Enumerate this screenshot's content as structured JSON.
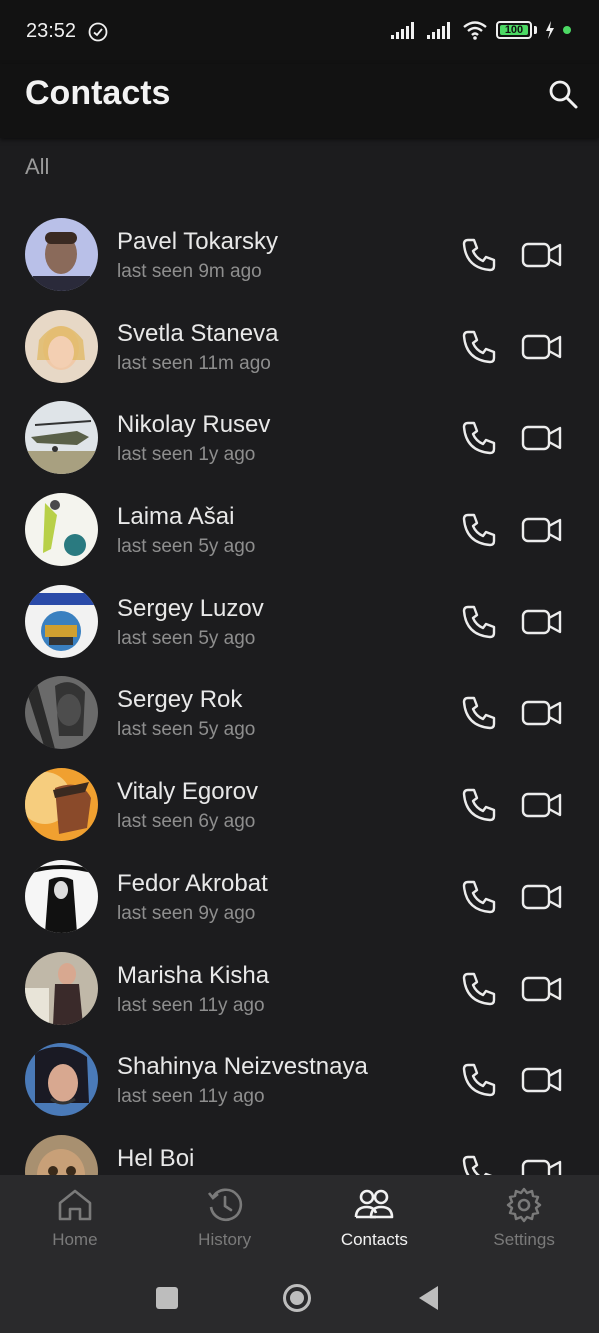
{
  "status_bar": {
    "time": "23:52",
    "battery": "100",
    "icons": [
      "check-circle-icon",
      "signal-icon",
      "signal-icon",
      "wifi-icon",
      "battery-icon",
      "charging-icon"
    ]
  },
  "app_bar": {
    "title": "Contacts",
    "search_icon": "search-icon"
  },
  "section": {
    "label": "All"
  },
  "contacts": [
    {
      "name": "Pavel Tokarsky",
      "status": "last seen 9m ago"
    },
    {
      "name": "Svetla Staneva",
      "status": "last seen 11m ago"
    },
    {
      "name": "Nikolay Rusev",
      "status": "last seen 1y ago"
    },
    {
      "name": "Laima Ašai",
      "status": "last seen 5y ago"
    },
    {
      "name": "Sergey Luzov",
      "status": "last seen 5y ago"
    },
    {
      "name": "Sergey Rok",
      "status": "last seen 5y ago"
    },
    {
      "name": "Vitaly Egorov",
      "status": "last seen 6y ago"
    },
    {
      "name": "Fedor Akrobat",
      "status": "last seen 9y ago"
    },
    {
      "name": "Marisha Kisha",
      "status": "last seen 11y ago"
    },
    {
      "name": "Shahinya Neizvestnaya",
      "status": "last seen 11y ago"
    },
    {
      "name": "Hel Boi",
      "status": ""
    }
  ],
  "bottom_nav": {
    "items": [
      {
        "label": "Home",
        "icon": "home-icon"
      },
      {
        "label": "History",
        "icon": "history-icon"
      },
      {
        "label": "Contacts",
        "icon": "contacts-icon",
        "active": true
      },
      {
        "label": "Settings",
        "icon": "settings-icon"
      }
    ]
  },
  "system_nav": {
    "icons": [
      "recents-icon",
      "home-circle-icon",
      "back-icon"
    ]
  },
  "colors": {
    "background": "#1c1c1e",
    "bar": "#121212",
    "nav": "#2a2a2c",
    "text_primary": "#e8e8e8",
    "text_secondary": "#8e8e8e",
    "battery": "#4cd964"
  }
}
